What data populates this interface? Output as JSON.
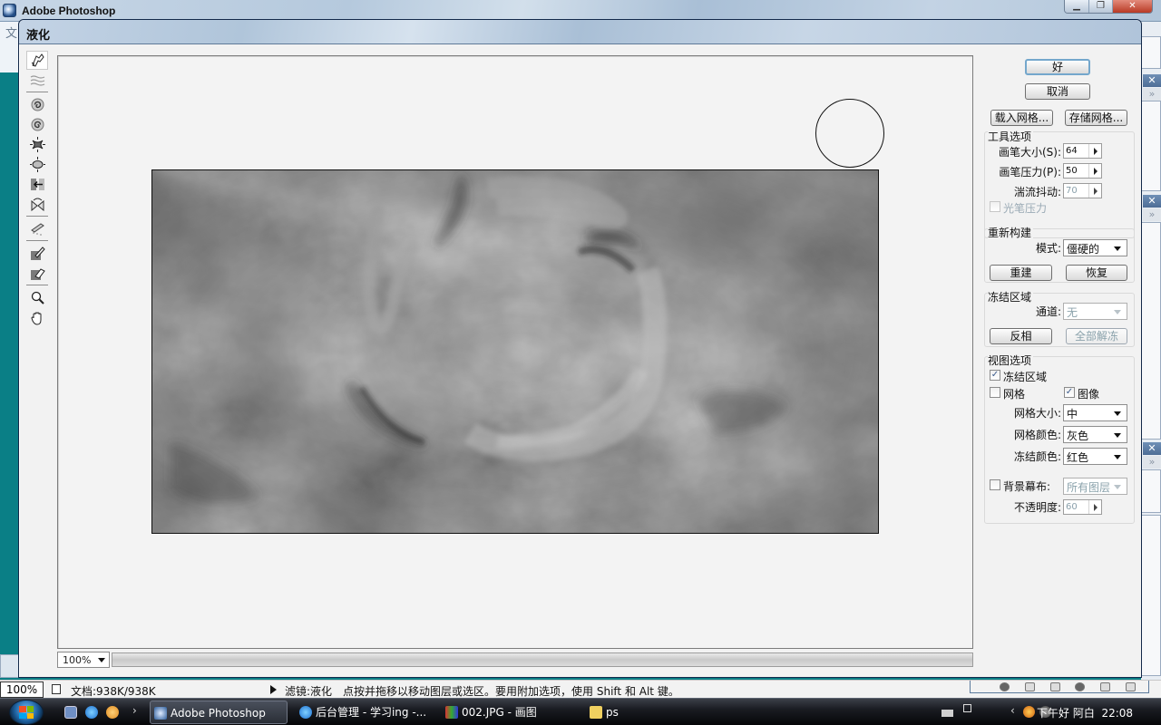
{
  "app": {
    "title": "Adobe Photoshop",
    "menu_fragment": "文",
    "window_controls": {
      "minimize": "minimize",
      "restore": "restore",
      "close": "close"
    }
  },
  "dialog": {
    "title": "液化",
    "tools": [
      {
        "name": "forward-warp-tool",
        "active": true
      },
      {
        "name": "turbulence-tool",
        "active": false
      },
      {
        "name": "twirl-clockwise-tool",
        "active": false
      },
      {
        "name": "twirl-counterclockwise-tool",
        "active": false
      },
      {
        "name": "pucker-tool",
        "active": false
      },
      {
        "name": "bloat-tool",
        "active": false
      },
      {
        "name": "push-left-tool",
        "active": false
      },
      {
        "name": "mirror-tool",
        "active": false
      },
      {
        "name": "reconstruct-tool",
        "active": false
      },
      {
        "name": "freeze-mask-tool",
        "active": false
      },
      {
        "name": "thaw-mask-tool",
        "active": false
      },
      {
        "name": "zoom-tool",
        "active": false
      },
      {
        "name": "hand-tool",
        "active": false
      }
    ],
    "zoom_level": "100%",
    "buttons": {
      "ok": "好",
      "cancel": "取消",
      "load_mesh": "载入网格...",
      "save_mesh": "存储网格..."
    },
    "tool_options": {
      "title": "工具选项",
      "brush_size_label": "画笔大小(S):",
      "brush_size": "64",
      "brush_pressure_label": "画笔压力(P):",
      "brush_pressure": "50",
      "turbulent_jitter_label": "湍流抖动:",
      "turbulent_jitter": "70",
      "stylus_pressure_label": "光笔压力",
      "stylus_pressure_checked": false
    },
    "reconstruct": {
      "title": "重新构建",
      "mode_label": "模式:",
      "mode_value": "僵硬的",
      "reconstruct_btn": "重建",
      "restore_btn": "恢复"
    },
    "freeze_area": {
      "title": "冻结区域",
      "channel_label": "通道:",
      "channel_value": "无",
      "invert_btn": "反相",
      "thaw_all_btn": "全部解冻"
    },
    "view_options": {
      "title": "视图选项",
      "frozen_areas_label": "冻结区域",
      "frozen_areas_checked": true,
      "mesh_label": "网格",
      "mesh_checked": false,
      "image_label": "图像",
      "image_checked": true,
      "mesh_size_label": "网格大小:",
      "mesh_size_value": "中",
      "mesh_color_label": "网格颜色:",
      "mesh_color_value": "灰色",
      "freeze_color_label": "冻结颜色:",
      "freeze_color_value": "红色",
      "backdrop_label": "背景幕布:",
      "backdrop_checked": false,
      "backdrop_value": "所有图层",
      "opacity_label": "不透明度:",
      "opacity_value": "60"
    }
  },
  "statusbar": {
    "zoom": "100%",
    "doc_info": "文档:938K/938K",
    "message": "滤镜:液化　点按并拖移以移动图层或选区。要用附加选项，使用 Shift 和 Alt 键。"
  },
  "taskbar": {
    "quick_launch_more": "›",
    "tasks": [
      {
        "label": "Adobe Photoshop",
        "active": true
      },
      {
        "label": "后台管理 - 学习ing -...",
        "active": false
      },
      {
        "label": "002.JPG - 画图",
        "active": false
      },
      {
        "label": "ps",
        "active": false
      }
    ],
    "tray_greeting": "下午好 阿白",
    "clock": "22:08"
  },
  "colors": {
    "desktop_teal": "#0a7f86",
    "dialog_bg": "#f2f2f2",
    "default_button_border": "#74a7cc",
    "checkbox_mark": "#3a5b8c",
    "panel_header": "#4d6d96"
  }
}
